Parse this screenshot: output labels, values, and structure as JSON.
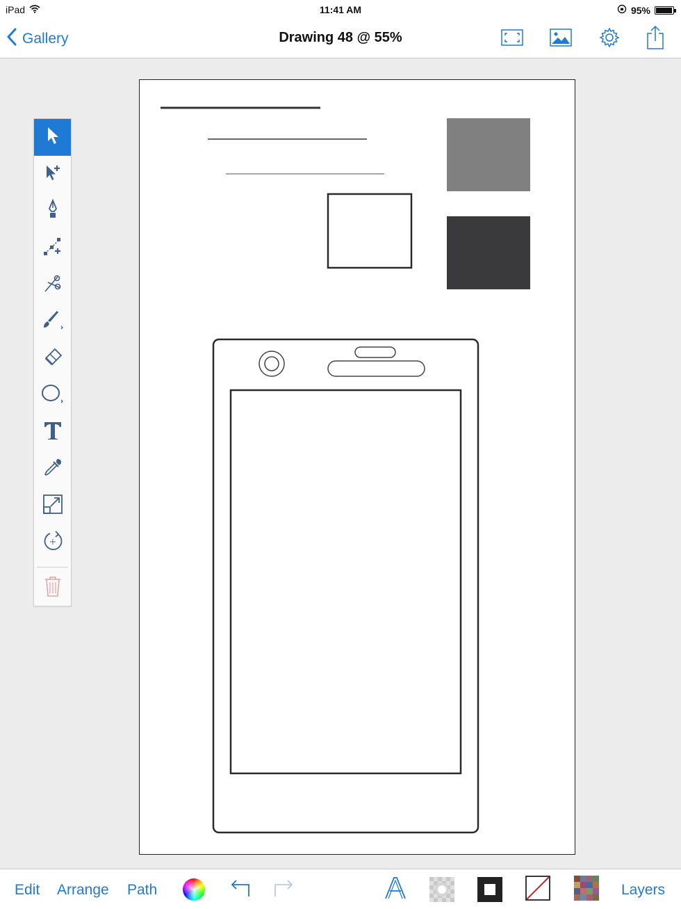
{
  "status": {
    "device": "iPad",
    "time": "11:41 AM",
    "battery": "95%"
  },
  "nav": {
    "back_label": "Gallery",
    "title": "Drawing 48 @ 55%"
  },
  "nav_icons": [
    "fullscreen-icon",
    "image-icon",
    "gear-icon",
    "share-icon"
  ],
  "tools": [
    "select-tool",
    "direct-select-tool",
    "pen-tool",
    "node-tool",
    "scissors-tool",
    "brush-tool",
    "eraser-tool",
    "shape-tool",
    "text-tool",
    "eyedropper-tool",
    "scale-tool",
    "rotate-tool",
    "delete-tool"
  ],
  "bottom": {
    "edit": "Edit",
    "arrange": "Arrange",
    "path": "Path",
    "layers": "Layers"
  },
  "colors": {
    "accent": "#1f7ad6",
    "gray_swatch": "#808080",
    "dark_swatch": "#3a3a3d",
    "delete": "#e8a0a0"
  }
}
